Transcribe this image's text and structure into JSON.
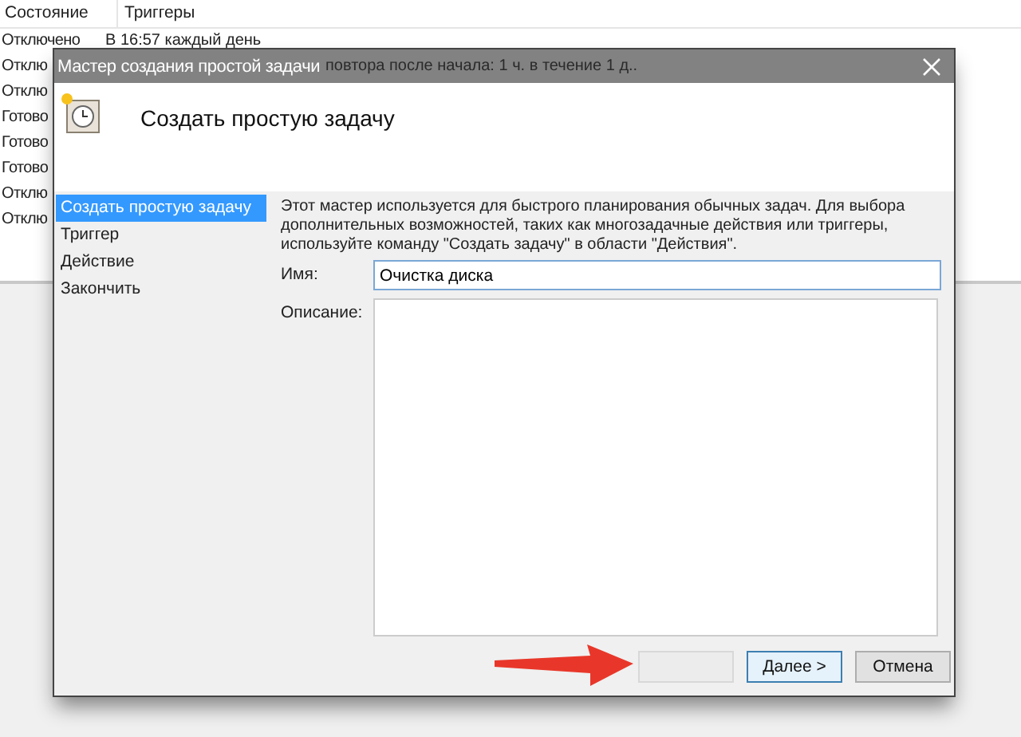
{
  "background_list": {
    "columns": [
      "Состояние",
      "Триггеры"
    ],
    "rows": [
      {
        "status": "Отключено",
        "trigger": "В 16:57 каждый день"
      },
      {
        "status": "Отклю",
        "trigger": "повтора после начала: 1 ч. в течение 1 д.."
      },
      {
        "status": "Отклю"
      },
      {
        "status": "Готово"
      },
      {
        "status": "Готово"
      },
      {
        "status": "Готово"
      },
      {
        "status": "Отклю"
      },
      {
        "status": "Отклю"
      }
    ]
  },
  "dialog": {
    "title": "Мастер создания простой задачи",
    "header": "Создать простую задачу",
    "steps": [
      {
        "label": "Создать простую задачу",
        "selected": true
      },
      {
        "label": "Триггер",
        "selected": false
      },
      {
        "label": "Действие",
        "selected": false
      },
      {
        "label": "Закончить",
        "selected": false
      }
    ],
    "intro": "Этот мастер используется для быстрого планирования обычных задач.  Для выбора дополнительных возможностей, таких как многозадачные действия или триггеры, используйте команду \"Создать задачу\" в области \"Действия\".",
    "name_label": "Имя:",
    "name_value": "Очистка диска",
    "description_label": "Описание:",
    "buttons": [
      {
        "kind": "back",
        "disabled": true
      },
      {
        "kind": "next",
        "label": "Далее >",
        "disabled": false
      },
      {
        "kind": "cancel",
        "label": "Отмена",
        "disabled": false
      }
    ]
  },
  "annotation": {
    "kind": "arrow"
  }
}
